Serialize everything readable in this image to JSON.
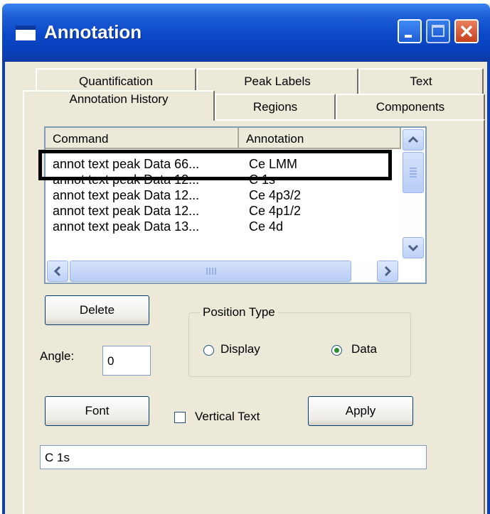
{
  "window": {
    "title": "Annotation"
  },
  "tabs": {
    "back": [
      "Quantification",
      "Peak Labels",
      "Text"
    ],
    "front": [
      "Annotation History",
      "Regions",
      "Components"
    ]
  },
  "list": {
    "headers": [
      "Command",
      "Annotation"
    ],
    "rows": [
      {
        "command": "annot text peak Data 66...",
        "annotation": "Ce LMM"
      },
      {
        "command": "annot text peak Data 12...",
        "annotation": "C 1s"
      },
      {
        "command": "annot text peak Data 12...",
        "annotation": "Ce 4p3/2"
      },
      {
        "command": "annot text peak Data 12...",
        "annotation": "Ce 4p1/2"
      },
      {
        "command": "annot text peak Data 13...",
        "annotation": "Ce 4d"
      }
    ]
  },
  "buttons": {
    "delete": "Delete",
    "font": "Font",
    "apply": "Apply"
  },
  "angle": {
    "label": "Angle:",
    "value": "0"
  },
  "position_type": {
    "legend": "Position Type",
    "options": [
      "Display",
      "Data"
    ],
    "selected": "Data"
  },
  "vertical_text": {
    "label": "Vertical Text",
    "checked": false
  },
  "text_field": {
    "value": "C 1s"
  }
}
